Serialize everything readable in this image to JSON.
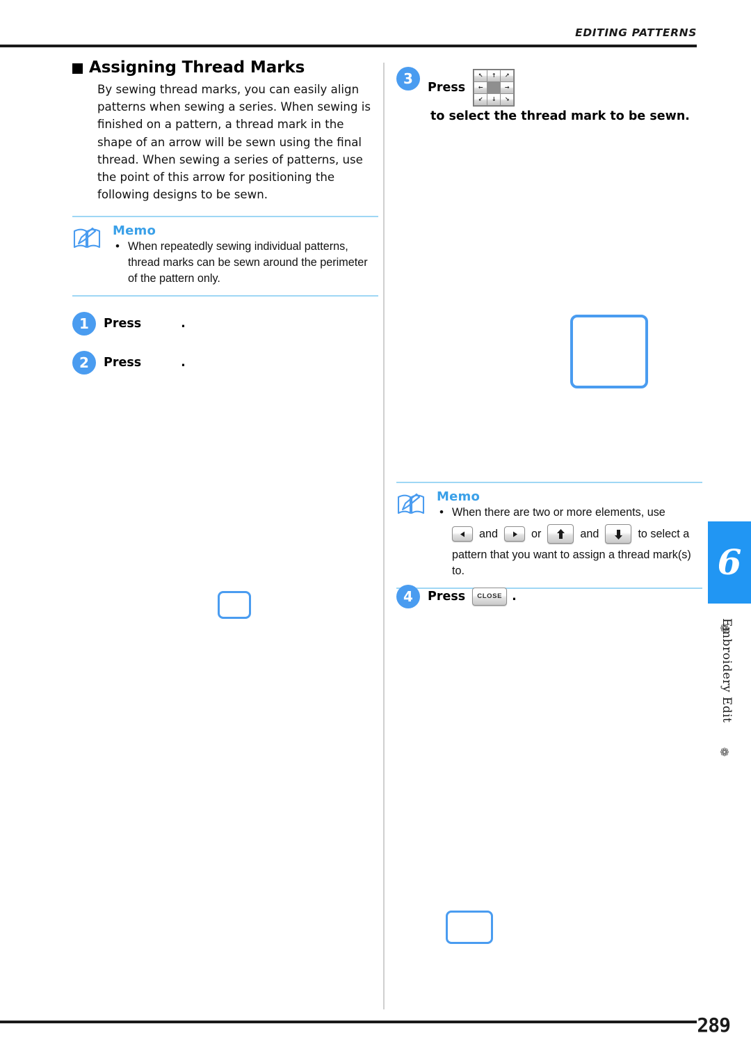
{
  "header": {
    "running_head": "EDITING PATTERNS"
  },
  "footer": {
    "page_number": "289"
  },
  "sidebar": {
    "chapter_number": "6",
    "chapter_label": "Embroidery Edit",
    "ornament": "❁",
    "tab_color": "#2196f3"
  },
  "colors": {
    "accent_blue": "#4a9cf0",
    "memo_title": "#3aa0e8",
    "memo_rule": "#9ed7f5",
    "rule_black": "#1a1a1a"
  },
  "left_column": {
    "section": {
      "bullet": "square-bullet",
      "title": "Assigning Thread Marks"
    },
    "intro_paragraph": "By sewing thread marks, you can easily align patterns when sewing a series. When sewing is finished on a pattern, a thread mark in the shape of an arrow will be sewn using the final thread. When sewing a series of patterns, use the point of this arrow for positioning the following designs to be sewn.",
    "memo": {
      "icon": "memo-book-pencil-icon",
      "title": "Memo",
      "items": [
        "When repeatedly sewing individual patterns, thread marks can be sewn around the perimeter of the pattern only."
      ]
    },
    "steps": [
      {
        "number": "1",
        "lead": "Press",
        "icon": "missing-key-icon",
        "tail": "."
      },
      {
        "number": "2",
        "lead": "Press",
        "icon": "missing-key-icon",
        "tail": "."
      }
    ],
    "figure_step2": "screen-placeholder-frame"
  },
  "right_column": {
    "steps": [
      {
        "number": "3",
        "lead": "Press",
        "icon": "dpad-9way-arrow-icon",
        "tail": "to select the thread mark to be sewn."
      },
      {
        "number": "4",
        "lead": "Press",
        "icon": "close-button-key",
        "icon_label": "CLOSE",
        "tail": "."
      }
    ],
    "figure_step3": "screen-placeholder-frame",
    "figure_step4": "screen-placeholder-frame",
    "memo": {
      "icon": "memo-book-pencil-icon",
      "title": "Memo",
      "line1": "When there are two or more elements, use",
      "inline": {
        "and1": "and",
        "or": "or",
        "and2": "and",
        "tail": "to select a",
        "left_icon": "arrow-left-key",
        "right_icon": "arrow-right-key",
        "up_icon": "arrow-up-key",
        "down_icon": "arrow-down-key"
      },
      "line3": "pattern that you want to assign a thread",
      "line4": "mark(s) to."
    }
  },
  "dpad": {
    "keys": [
      "↖",
      "↑",
      "↗",
      "←",
      "",
      "→",
      "↙",
      "↓",
      "↘"
    ]
  }
}
